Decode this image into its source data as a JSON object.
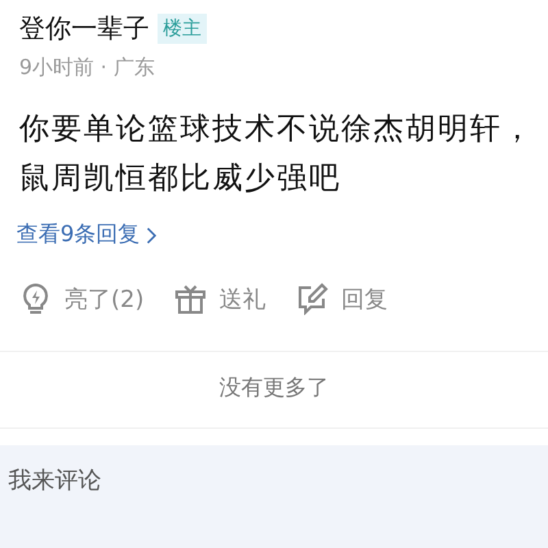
{
  "post": {
    "author": "登你一辈子",
    "badge": "楼主",
    "meta": "9小时前 · 广东",
    "body": "你要单论篮球技术不说徐杰胡明轩，鼠周凯恒都比威少强吧",
    "replies_link": "查看9条回复"
  },
  "actions": [
    {
      "kind": "like",
      "label": "亮了(2)"
    },
    {
      "kind": "gift",
      "label": "送礼"
    },
    {
      "kind": "reply",
      "label": "回复"
    }
  ],
  "end_note": "没有更多了",
  "comment_bar": {
    "placeholder": "我来评论"
  }
}
